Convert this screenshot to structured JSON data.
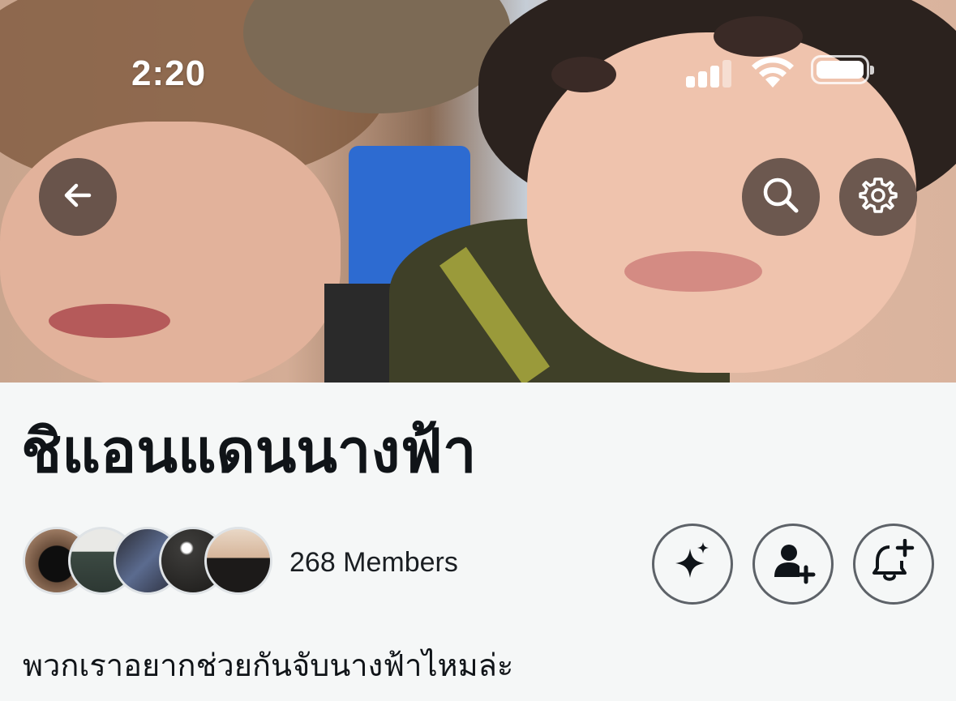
{
  "status_bar": {
    "time": "2:20"
  },
  "header": {
    "cover_description": "cover photo",
    "buttons": {
      "back_icon": "arrow-left-icon",
      "search_icon": "search-icon",
      "settings_icon": "gear-icon"
    }
  },
  "community": {
    "title": "ชิแอนแดนนางฟ้า",
    "members_label": "268 Members",
    "description": "พวกเราอยากช่วยกันจับนางฟ้าไหมล่ะ"
  },
  "actions": {
    "ai_icon": "sparkle-icon",
    "invite_icon": "add-person-icon",
    "notify_icon": "bell-plus-icon"
  },
  "colors": {
    "background": "#f5f7f7",
    "title_text": "#101418",
    "overlay_button": "#463a34"
  }
}
